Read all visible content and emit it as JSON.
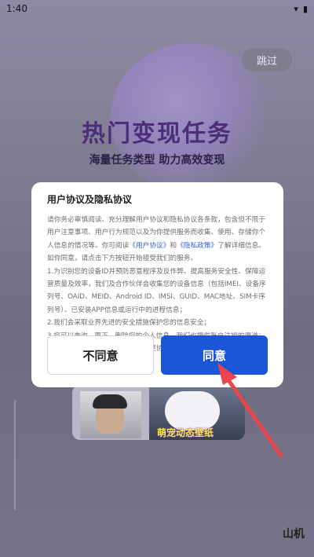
{
  "status_bar": {
    "time": "1:40",
    "wifi_icon": "wifi-icon",
    "battery_icon": "battery-icon"
  },
  "skip_label": "跳过",
  "hero": {
    "title": "热门变现任务",
    "subtitle": "海量任务类型  助力高效变现"
  },
  "background_card_label": "萌宠动态壁纸",
  "corner_text": "山机",
  "dialog": {
    "title": "用户协议及隐私协议",
    "intro": "请你务必审慎阅读、充分理解用户协议和隐私协议各条款，包含但不限于用户注意事项、用户行为规范以及为你提供服务而收集、使用、存储你个人信息的情况等。你可阅读",
    "link_user": "《用户协议》",
    "and": "和",
    "link_privacy": "《隐私政策》",
    "intro_end": "了解详细信息。",
    "agree_lead": "如你同意，请点击下方按钮开始接受我们的服务。",
    "item1": "1.为识别您的设备ID并预防恶意程序及反作弊、提高服务安全性、保障运营质量及效率，我们及合作伙伴会收集您的设备信息（包括IMEI、设备序列号、OAID、MEID、Android ID、IMSI、GUID、MAC地址、SIM卡序列号）、已安装APP信息或运行中的进程信息；",
    "item2": "2.我们会采取业界先进的安全措施保护您的信息安全；",
    "item3": "3.您可以查询、更正、删除您的个人信息，我们也提供账户注销的渠道；需要请您注意的是，如您不同意上述协议内容，我们将无法为您提供服务。",
    "disagree_label": "不同意",
    "agree_label": "同意"
  },
  "colors": {
    "accent": "#1a56d6",
    "arrow": "#e8464a",
    "title": "#4a2e78"
  }
}
